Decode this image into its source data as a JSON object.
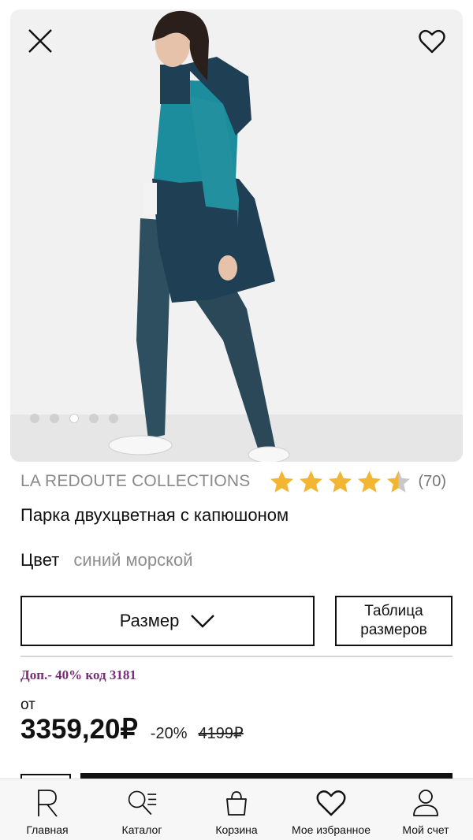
{
  "gallery": {
    "dots": [
      false,
      false,
      true,
      false,
      false
    ],
    "icons": {
      "close": "close-icon",
      "favorite": "heart-icon"
    }
  },
  "product": {
    "brand": "LA REDOUTE COLLECTIONS",
    "rating": 4.5,
    "rating_max": 5,
    "reviews": "(70)",
    "title": "Парка двухцветная с капюшоном",
    "color_label": "Цвет",
    "color_value": "синий морской",
    "star_color": "#f2b632"
  },
  "actions": {
    "size_label": "Размер",
    "size_table_line1": "Таблица",
    "size_table_line2": "размеров"
  },
  "pricing": {
    "promo": "Доп.- 40% код 3181",
    "promo_color": "#7a2d77",
    "from_label": "от",
    "price": "3359,20₽",
    "discount": "-20%",
    "old_price": "4199₽"
  },
  "tabbar": {
    "tabs": [
      {
        "label": "Главная",
        "icon": "logo-r-icon"
      },
      {
        "label": "Каталог",
        "icon": "search-list-icon"
      },
      {
        "label": "Корзина",
        "icon": "bag-icon"
      },
      {
        "label": "Мое избранное",
        "icon": "heart-icon"
      },
      {
        "label": "Мой счет",
        "icon": "user-icon"
      }
    ]
  }
}
